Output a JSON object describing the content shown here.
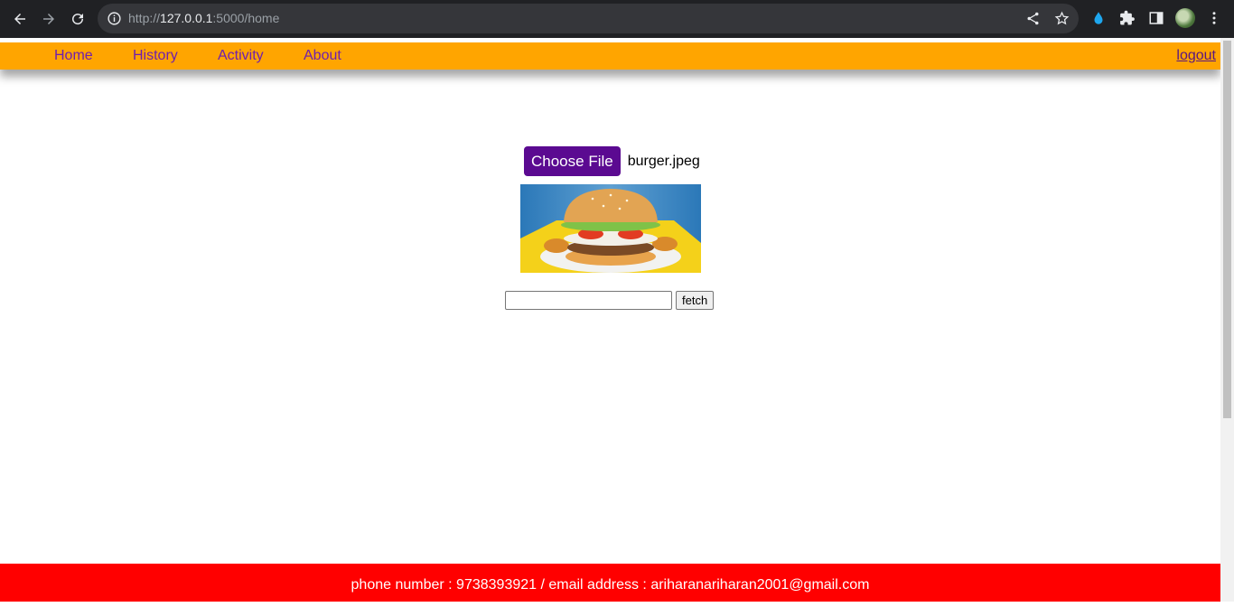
{
  "browser": {
    "url_scheme": "http://",
    "url_host": "127.0.0.1",
    "url_rest": ":5000/home"
  },
  "nav": {
    "items": [
      {
        "label": "Home"
      },
      {
        "label": "History"
      },
      {
        "label": "Activity"
      },
      {
        "label": "About"
      }
    ],
    "logout_label": "logout",
    "link_color": "#6f1fae",
    "bar_color": "#ffa500"
  },
  "upload": {
    "choose_label": "Choose File",
    "file_name": "burger.jpeg",
    "button_color": "#5b0a91",
    "preview_alt": "burger image"
  },
  "fetch": {
    "input_value": "",
    "button_label": "fetch"
  },
  "footer": {
    "text": "phone number : 9738393921 / email address : ariharanariharan2001@gmail.com",
    "color": "#ff0000"
  }
}
